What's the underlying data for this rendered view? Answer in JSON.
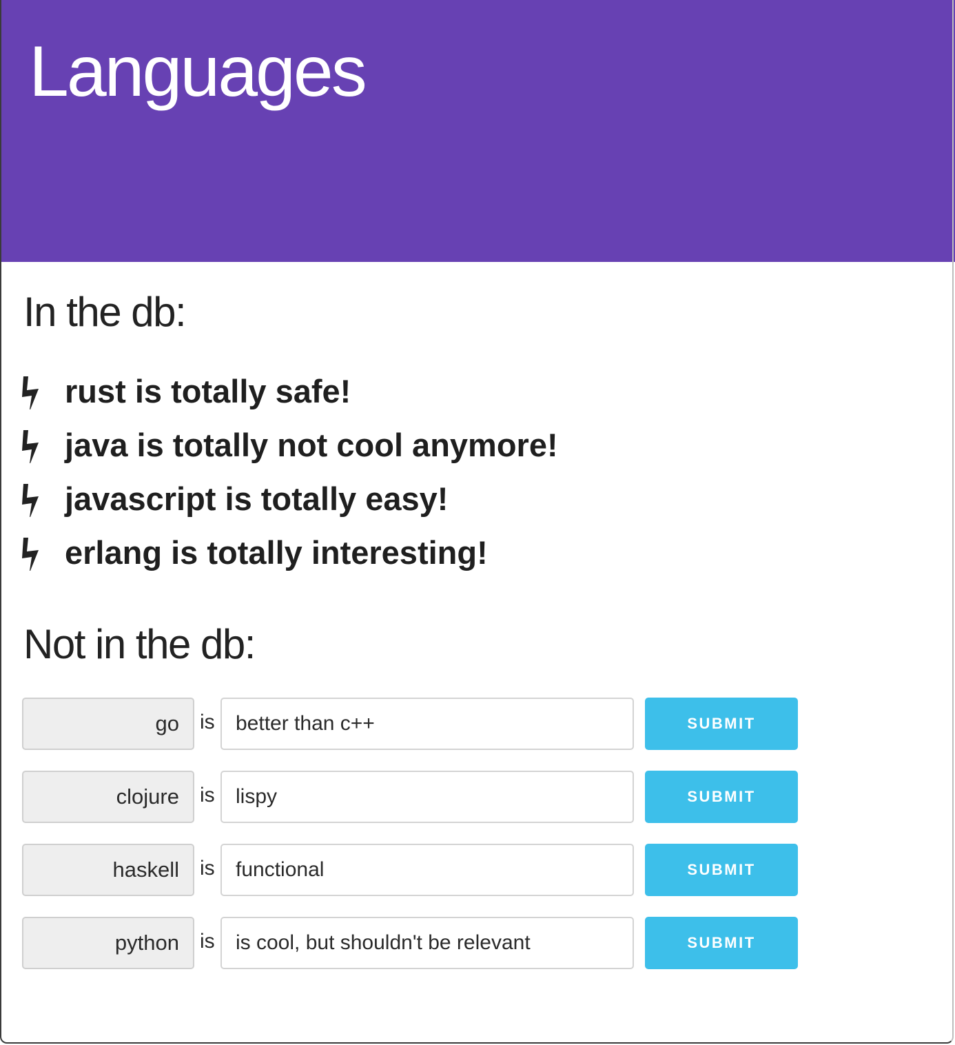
{
  "header": {
    "title": "Languages",
    "background_color": "#6741b3"
  },
  "in_db": {
    "title": "In the db:",
    "icon": "lightning-bolt-icon",
    "items": [
      {
        "text": "rust is totally safe!"
      },
      {
        "text": "java is totally not cool anymore!"
      },
      {
        "text": "javascript is totally easy!"
      },
      {
        "text": "erlang is totally interesting!"
      }
    ]
  },
  "not_in_db": {
    "title": "Not in the db:",
    "connector": "is",
    "submit_label": "SUBMIT",
    "submit_color": "#3dbfea",
    "rows": [
      {
        "language": "go",
        "description": "better than c++"
      },
      {
        "language": "clojure",
        "description": "lispy"
      },
      {
        "language": "haskell",
        "description": "functional"
      },
      {
        "language": "python",
        "description": "is cool, but shouldn't be relevant"
      }
    ]
  }
}
